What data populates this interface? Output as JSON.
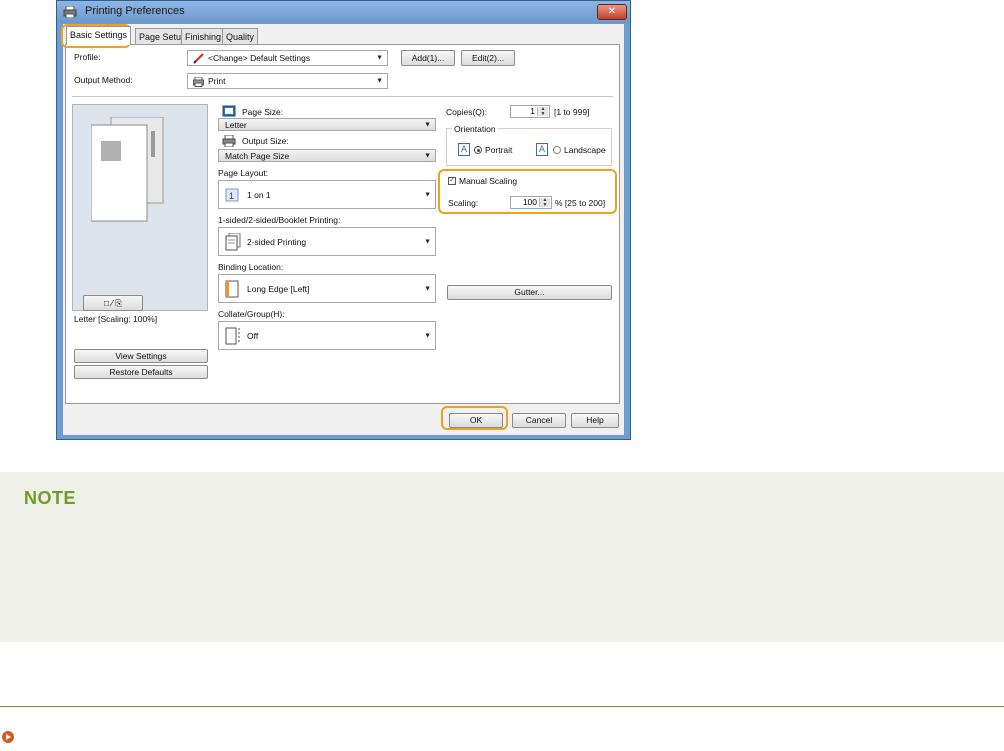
{
  "window": {
    "title": "Printing Preferences",
    "close_label": "✕"
  },
  "tabs": [
    "Basic Settings",
    "Page Setup",
    "Finishing",
    "Quality"
  ],
  "profile": {
    "label": "Profile:",
    "value": "<Change> Default Settings",
    "add_label": "Add(1)...",
    "edit_label": "Edit(2)..."
  },
  "output_method": {
    "label": "Output Method:",
    "value": "Print"
  },
  "preview": {
    "caption": "Letter [Scaling: 100%]",
    "view_settings_label": "View Settings",
    "restore_defaults_label": "Restore Defaults"
  },
  "page_size": {
    "label": "Page Size:",
    "value": "Letter"
  },
  "output_size": {
    "label": "Output Size:",
    "value": "Match Page Size"
  },
  "page_layout": {
    "label": "Page Layout:",
    "value": "1 on 1"
  },
  "sided": {
    "label": "1-sided/2-sided/Booklet Printing:",
    "value": "2-sided Printing"
  },
  "binding": {
    "label": "Binding Location:",
    "value": "Long Edge [Left]",
    "gutter_label": "Gutter..."
  },
  "collate": {
    "label": "Collate/Group(H):",
    "value": "Off"
  },
  "copies": {
    "label": "Copies(Q):",
    "value": "1",
    "range": "[1 to 999]"
  },
  "orientation": {
    "label": "Orientation",
    "portrait": "Portrait",
    "landscape": "Landscape",
    "icon_letter": "A"
  },
  "scaling": {
    "manual_label": "Manual Scaling",
    "label": "Scaling:",
    "value": "100",
    "range": "% [25 to 200]"
  },
  "footer": {
    "ok_label": "OK",
    "cancel_label": "Cancel",
    "help_label": "Help"
  },
  "note": {
    "title": "NOTE"
  },
  "colors": {
    "accent": "#6e9d2b",
    "highlight": "#f0a020",
    "bullet": "#d85a1e"
  }
}
